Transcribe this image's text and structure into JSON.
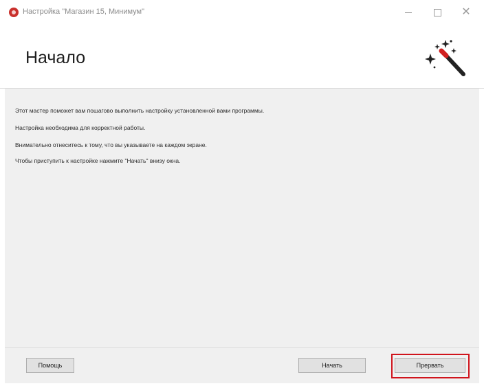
{
  "window": {
    "title": "Настройка \"Магазин 15, Минимум\"",
    "icon": "app-icon",
    "controls": [
      "minimize-icon",
      "maximize-icon",
      "close-icon"
    ]
  },
  "header": {
    "title": "Начало",
    "icon": "magic-wand-icon"
  },
  "content": {
    "lines": [
      "Этот мастер поможет вам пошагово выполнить настройку установленной вами программы.",
      "Настройка необходима для корректной работы.",
      "Внимательно отнеситесь к тому, что вы указываете на каждом экране.",
      "Чтобы приступить к настройке нажмите \"Начать\" внизу окна."
    ]
  },
  "footer": {
    "help_label": "Помощь",
    "start_label": "Начать",
    "abort_label": "Прервать"
  },
  "colors": {
    "highlight": "#d0141c",
    "content_bg": "#f0f0f0",
    "app_icon": "#c9302c"
  }
}
